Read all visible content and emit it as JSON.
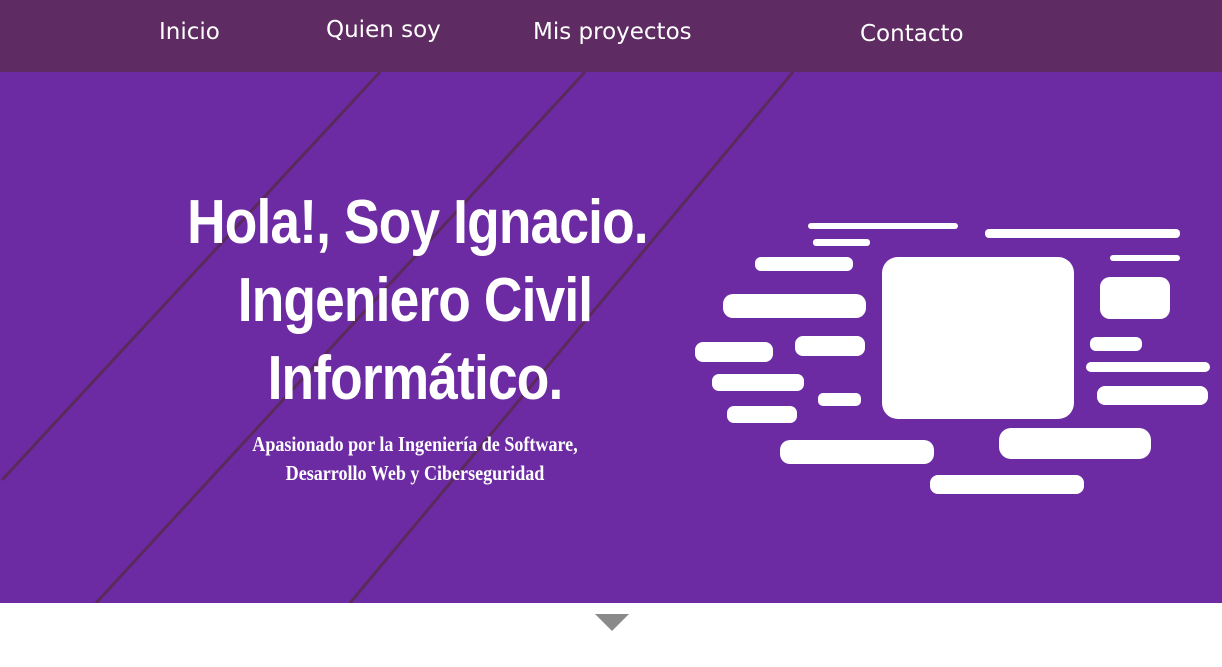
{
  "nav": {
    "items": [
      {
        "label": "Inicio"
      },
      {
        "label": "Quien soy"
      },
      {
        "label": "Mis proyectos"
      },
      {
        "label": "Contacto"
      }
    ]
  },
  "hero": {
    "title_lines": [
      "Hola!, Soy Ignacio.",
      "Ingeniero Civil",
      "Informático."
    ],
    "subtitle_lines": [
      "Apasionado por la Ingeniería de Software,",
      "Desarrollo Web y Ciberseguridad"
    ],
    "illustration_icon": "computer-screen-icon"
  },
  "colors": {
    "navbar": "#5e2b62",
    "hero_background": "#6c2ba3",
    "hero_stripes": "#5b2a5c",
    "text": "#ffffff",
    "arrow": "#8a8a8a"
  },
  "scroll_indicator": {
    "icon": "chevron-down-icon"
  }
}
